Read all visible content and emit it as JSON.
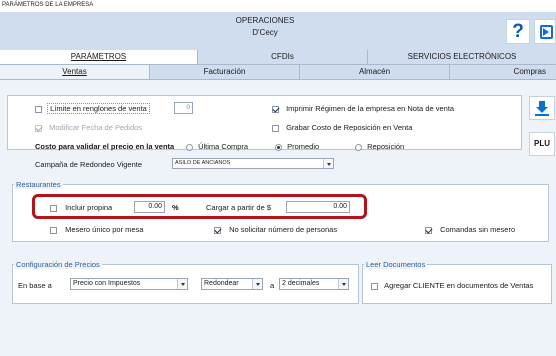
{
  "window": {
    "title": "PARÁMETROS DE LA EMPRESA"
  },
  "header": {
    "line1": "OPERACIONES",
    "line2": "D'Cecy",
    "help_label": "?"
  },
  "main_tabs": [
    {
      "label": "PARÁMETROS",
      "active": true
    },
    {
      "label": "CFDIs",
      "active": false
    },
    {
      "label": "SERVICIOS ELECTRÓNICOS",
      "active": false
    }
  ],
  "sub_tabs": [
    {
      "label": "Ventas",
      "active": true
    },
    {
      "label": "Facturación",
      "active": false
    },
    {
      "label": "Almacén",
      "active": false
    },
    {
      "label": "Compras",
      "active": false
    }
  ],
  "ventas": {
    "limite_label": "Límite en renglones de venta",
    "limite_value": "0",
    "imprimir_regimen_label": "Imprimir Régimen de la empresa en Nota de venta",
    "modificar_fecha_label": "Modificar Fecha de Pedidos",
    "grabar_costo_label": "Grabar Costo de Reposición en Venta",
    "costo_validar_label": "Costo para validar el precio en la venta",
    "costo_options": [
      "Última Compra",
      "Promedio",
      "Reposición"
    ],
    "costo_selected": "Promedio",
    "campana_label": "Campaña de Redondeo Vigente",
    "campana_value": "ASILO DE ANCIANOS"
  },
  "restaurantes": {
    "title": "Restaurantes",
    "incluir_propina_label": "Incluir propina",
    "propina_value": "0.00",
    "percent_symbol": "%",
    "cargar_label": "Cargar a partir de  $",
    "cargar_value": "0.00",
    "mesero_unico_label": "Mesero único por mesa",
    "no_solicitar_label": "No solicitar número de personas",
    "comandas_label": "Comandas sin mesero"
  },
  "config_precios": {
    "title": "Configuración de Precios",
    "en_base_label": "En base a",
    "base_value": "Precio con Impuestos",
    "redondear_value": "Redondear",
    "a_label": "a",
    "decimales_value": "2 decimales"
  },
  "leer_documentos": {
    "title": "Leer Documentos",
    "agregar_label": "Agregar CLIENTE en documentos de Ventas"
  },
  "side_buttons": {
    "plu_label": "PLU"
  },
  "colors": {
    "accent": "#0a6fd0",
    "highlight_border": "#b3141c",
    "header_bg": "#cfddef"
  }
}
